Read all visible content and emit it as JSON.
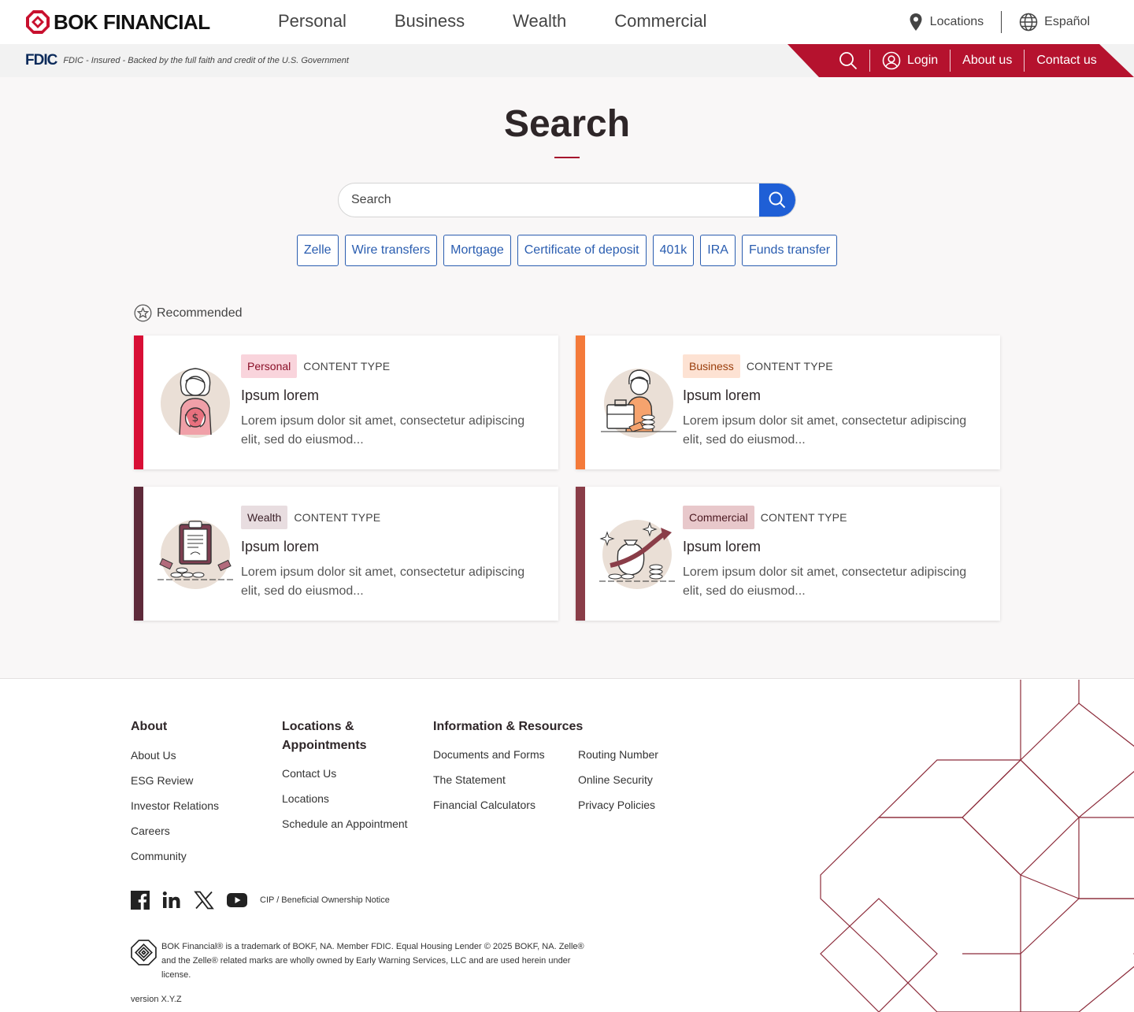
{
  "header": {
    "brand": "BOK FINANCIAL",
    "nav": [
      "Personal",
      "Business",
      "Wealth",
      "Commercial"
    ],
    "locations_label": "Locations",
    "language_label": "Español"
  },
  "subbar": {
    "fdic_logo": "FDIC",
    "fdic_text": "FDIC - Insured - Backed by the full faith and credit of the U.S. Government",
    "utility": {
      "login": "Login",
      "about": "About us",
      "contact": "Contact us"
    },
    "accent_color": "#b5122e"
  },
  "main": {
    "title": "Search",
    "search": {
      "placeholder": "Search",
      "value": ""
    },
    "chips": [
      "Zelle",
      "Wire transfers",
      "Mortgage",
      "Certificate of deposit",
      "401k",
      "IRA",
      "Funds transfer"
    ],
    "recommended_label": "Recommended",
    "cards": [
      {
        "tag": "Personal",
        "content_type": "CONTENT TYPE",
        "title": "Ipsum lorem",
        "description": "Lorem ipsum dolor sit amet, consectetur adipiscing elit, sed do eiusmod...",
        "accent": "#d80f35",
        "tag_bg": "#f9d4dc",
        "tag_color": "#8a0f27",
        "icon": "person-money-icon"
      },
      {
        "tag": "Business",
        "content_type": "CONTENT TYPE",
        "title": "Ipsum lorem",
        "description": "Lorem ipsum dolor sit amet, consectetur adipiscing elit, sed do eiusmod...",
        "accent": "#f47a3a",
        "tag_bg": "#fde2d3",
        "tag_color": "#9a3e0c",
        "icon": "person-briefcase-icon"
      },
      {
        "tag": "Wealth",
        "content_type": "CONTENT TYPE",
        "title": "Ipsum lorem",
        "description": "Lorem ipsum dolor sit amet, consectetur adipiscing elit, sed do eiusmod...",
        "accent": "#5e2a3a",
        "tag_bg": "#e8dde0",
        "tag_color": "#3b2028",
        "icon": "clipboard-coins-icon"
      },
      {
        "tag": "Commercial",
        "content_type": "CONTENT TYPE",
        "title": "Ipsum lorem",
        "description": "Lorem ipsum dolor sit amet, consectetur adipiscing elit, sed do eiusmod...",
        "accent": "#8a3d48",
        "tag_bg": "#e8c8cb",
        "tag_color": "#4a1820",
        "icon": "money-bag-growth-icon"
      }
    ]
  },
  "footer": {
    "about": {
      "heading": "About",
      "links": [
        "About Us",
        "ESG Review",
        "Investor Relations",
        "Careers",
        "Community"
      ]
    },
    "locations": {
      "heading": "Locations & Appointments",
      "links": [
        "Contact Us",
        "Locations",
        "Schedule an Appointment"
      ]
    },
    "resources": {
      "heading": "Information & Resources",
      "links_left": [
        "Documents and Forms",
        "The Statement",
        "Financial Calculators"
      ],
      "links_right": [
        "Routing Number",
        "Online Security",
        "Privacy Policies"
      ]
    },
    "cip_link": "CIP / Beneficial Ownership Notice",
    "legal": "BOK Financial® is a trademark of BOKF, NA. Member FDIC. Equal Housing Lender © 2025 BOKF, NA. Zelle® and the Zelle® related marks are wholly owned by Early Warning Services, LLC and are used herein under license.",
    "version": "version X.Y.Z"
  }
}
